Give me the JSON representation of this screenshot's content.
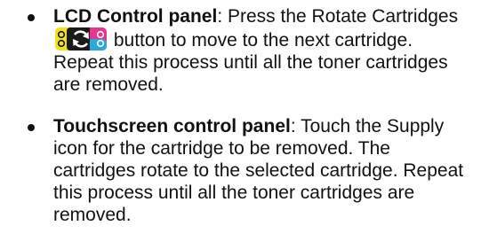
{
  "items": [
    {
      "title": "LCD Control panel",
      "text_before": ": Press the Rotate Cartridges ",
      "button_icon": "rotate-cartridges-icon",
      "text_after": " button to move to the next cartridge. Repeat this process until all the toner cartridges are removed."
    },
    {
      "title": "Touchscreen control panel",
      "text": ": Touch the Supply icon for the cartridge to be removed. The cartridges rotate to the selected cartridge. Repeat this process until all the toner cartridges are removed."
    }
  ],
  "colors": {
    "yellow": "#f2e21b",
    "magenta": "#e8348a",
    "cyan": "#2aa7dd",
    "dark": "#1a1a1a"
  }
}
